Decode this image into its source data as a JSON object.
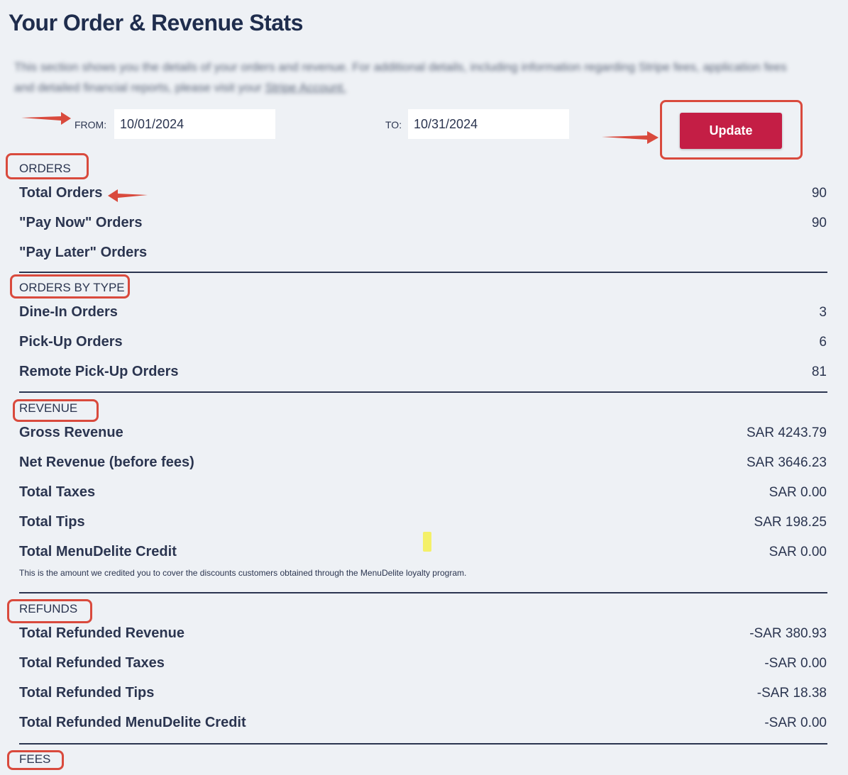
{
  "page": {
    "title": "Your Order & Revenue Stats",
    "intro_text": "This section shows you the details of your orders and revenue. For additional details, including information regarding Stripe fees, application fees and detailed financial reports, please visit your",
    "intro_link": "Stripe Account."
  },
  "filters": {
    "from_label": "FROM:",
    "from_value": "10/01/2024",
    "to_label": "TO:",
    "to_value": "10/31/2024",
    "update_label": "Update"
  },
  "colors": {
    "accent": "#c41e45",
    "annotation": "#d94a3d",
    "background": "#eef1f5",
    "text": "#2b3550"
  },
  "sections": {
    "orders": {
      "label": "ORDERS",
      "rows": [
        {
          "label": "Total Orders",
          "value": "90"
        },
        {
          "label": "\"Pay Now\" Orders",
          "value": "90"
        },
        {
          "label": "\"Pay Later\" Orders",
          "value": ""
        }
      ]
    },
    "orders_by_type": {
      "label": "ORDERS BY TYPE",
      "rows": [
        {
          "label": "Dine-In Orders",
          "value": "3"
        },
        {
          "label": "Pick-Up Orders",
          "value": "6"
        },
        {
          "label": "Remote Pick-Up Orders",
          "value": "81"
        }
      ]
    },
    "revenue": {
      "label": "REVENUE",
      "rows": [
        {
          "label": "Gross Revenue",
          "value": "SAR 4243.79"
        },
        {
          "label": "Net Revenue (before fees)",
          "value": "SAR 3646.23"
        },
        {
          "label": "Total Taxes",
          "value": "SAR 0.00"
        },
        {
          "label": "Total Tips",
          "value": "SAR 198.25"
        },
        {
          "label": "Total MenuDelite Credit",
          "value": "SAR 0.00"
        }
      ],
      "note": "This is the amount we credited you to cover the discounts customers obtained through the MenuDelite loyalty program."
    },
    "refunds": {
      "label": "REFUNDS",
      "rows": [
        {
          "label": "Total Refunded Revenue",
          "value": "-SAR 380.93"
        },
        {
          "label": "Total Refunded Taxes",
          "value": "-SAR 0.00"
        },
        {
          "label": "Total Refunded Tips",
          "value": "-SAR 18.38"
        },
        {
          "label": "Total Refunded MenuDelite Credit",
          "value": "-SAR 0.00"
        }
      ]
    },
    "fees": {
      "label": "FEES"
    }
  }
}
